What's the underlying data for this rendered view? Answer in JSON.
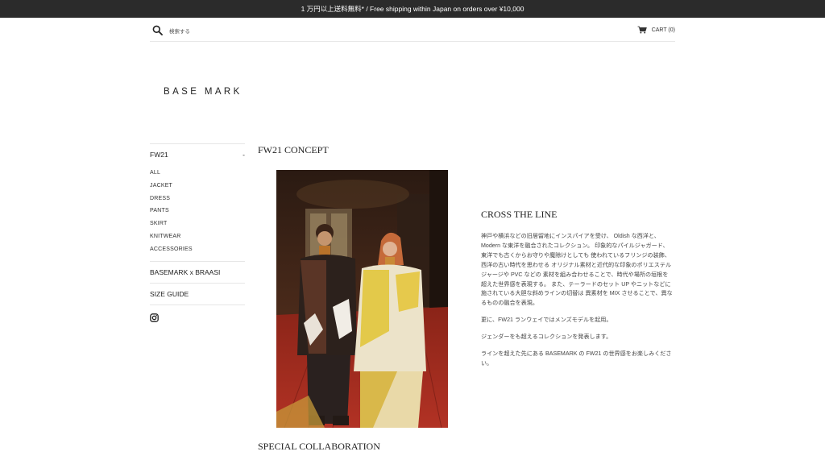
{
  "announcement": "1 万円以上送料無料* / Free shipping within Japan on orders over ¥10,000",
  "header": {
    "search_placeholder": "検索する",
    "cart_label": "CART (0)"
  },
  "brand": {
    "logo": "BASE MARK"
  },
  "sidebar": {
    "collection": {
      "label": "FW21",
      "toggle": "-"
    },
    "sub_items": [
      "ALL",
      "JACKET",
      "DRESS",
      "PANTS",
      "SKIRT",
      "KNITWEAR",
      "ACCESSORIES"
    ],
    "links": [
      "BASEMARK x BRAASI",
      "SIZE GUIDE"
    ],
    "social_icon": "instagram-icon"
  },
  "main": {
    "title": "FW21 CONCEPT",
    "image_icon": "lookbook-photo",
    "copy": {
      "heading": "CROSS THE LINE",
      "paragraphs": [
        "神戸や横浜などの旧居留地にインスパイアを受け、 Oldish な西洋と、Modern な東洋を融合されたコレクション。 印象的なパイルジャガード、東洋でも古くからお守りや魔除けとしても 使われているフリンジの装飾、西洋の古い時代を思わせる オリジナル素材と近代的な印象のポリエステルジャージや PVC などの 素材を組み合わせることで、時代や場所の垣根を超えた世界感を表現する。 また、テーラードのセット UP やニットなどに施されている大胆な斜めラインの切替は 異素材を MIX させることで、異なるものの融合を表現。",
        "更に、FW21 ランウェイではメンズモデルを起用。",
        "ジェンダーをも超えるコレクションを発表します。",
        "ラインを超えた先にある BASEMARK の FW21 の世界感をお楽しみください。"
      ]
    },
    "next_section_title": "SPECIAL COLLABORATION"
  },
  "colors": {
    "announce_bg": "#2b2b2b",
    "text": "#333333",
    "divider": "#e6e6e6"
  }
}
